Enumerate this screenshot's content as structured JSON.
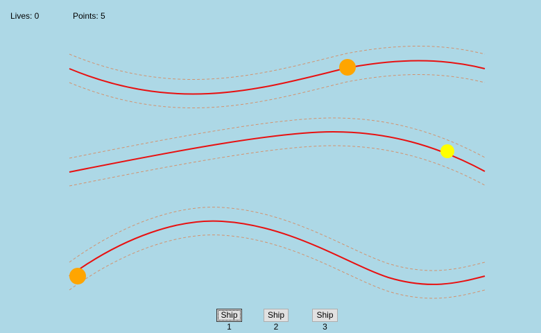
{
  "hud": {
    "lives_label": "Lives: 0",
    "points_label": "Points: 5"
  },
  "colors": {
    "background": "#ADD8E6",
    "track_line": "#E81010",
    "track_border": "#D2926E",
    "ship_orange": "#FFA500",
    "ship_yellow": "#FFFF00"
  },
  "ships": [
    {
      "label": "Ship 1",
      "selected": true
    },
    {
      "label": "Ship 2",
      "selected": false
    },
    {
      "label": "Ship 3",
      "selected": false
    }
  ]
}
